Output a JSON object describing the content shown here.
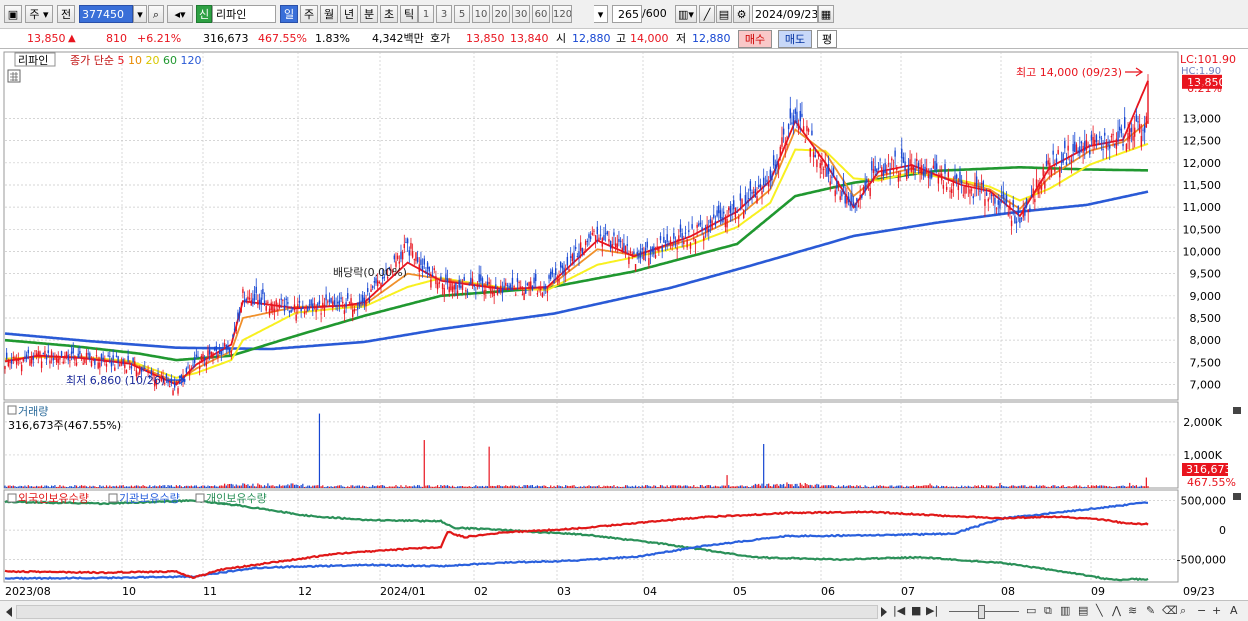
{
  "toolbar": {
    "type_label": "주",
    "prev_label": "전",
    "code": "377450",
    "credit_badge": "신",
    "stock_name": "리파인",
    "periods": [
      "일",
      "주",
      "월",
      "년",
      "분",
      "초",
      "틱"
    ],
    "active_period": "일",
    "intervals": [
      "1",
      "3",
      "5",
      "10",
      "20",
      "30",
      "60",
      "120"
    ],
    "count": "265",
    "count_total": "/600",
    "date": "2024/09/23"
  },
  "quote": {
    "price": "13,850",
    "change": "810",
    "rate": "+6.21%",
    "volume": "316,673",
    "volume_ratio": "467.55%",
    "turnover": "1.83%",
    "amount": "4,342백만",
    "ask_label": "호가",
    "ask": "13,850",
    "bid": "13,840",
    "open_label": "시",
    "open": "12,880",
    "high_label": "고",
    "high": "14,000",
    "low_label": "저",
    "low": "12,880",
    "buy_label": "매수",
    "sell_label": "매도",
    "eval_label": "평"
  },
  "price_panel": {
    "stock_label": "리파인",
    "ma_legend_title": "종가 단순",
    "ma_periods": [
      "5",
      "10",
      "20",
      "60",
      "120"
    ],
    "lc_label": "LC:101.90",
    "hc_label": "HC:1.90",
    "current_price_label": "13,850",
    "change_rate_label": "6.21%",
    "high_annotation": "최고 14,000 (09/23)",
    "low_annotation": "최저 6,860 (10/26)",
    "dividend_annotation": "배당락(0.00%)"
  },
  "volume_panel": {
    "title": "거래량",
    "subtitle": "316,673주(467.55%)",
    "current_label": "316,673",
    "ratio_label": "467.55%"
  },
  "holding_panel": {
    "series_labels": [
      "외국인보유수량",
      "기관보유수량",
      "개인보유수량"
    ]
  },
  "colors": {
    "up": "#e8141e",
    "down": "#1646d2",
    "ma5": "#e8141e",
    "ma10": "#f0902a",
    "ma20": "#f8f020",
    "ma60": "#209830",
    "ma120": "#2a5ad6",
    "foreign": "#e01818",
    "institution": "#2a60dd",
    "individual": "#2a9058"
  },
  "chart_data": [
    {
      "type": "candlestick",
      "title": "리파인",
      "x_labels": [
        "2023/08",
        "10",
        "11",
        "12",
        "2024/01",
        "02",
        "03",
        "04",
        "05",
        "06",
        "07",
        "08",
        "09",
        "09/23"
      ],
      "y_ticks": [
        7000,
        7500,
        8000,
        8500,
        9000,
        9500,
        10000,
        10500,
        11000,
        11500,
        12000,
        12500,
        13000
      ],
      "y_range": [
        6650,
        14500
      ],
      "series": [
        {
          "name": "5",
          "anchors": [
            [
              0,
              7520
            ],
            [
              20,
              7650
            ],
            [
              45,
              7600
            ],
            [
              75,
              7470
            ],
            [
              103,
              7000
            ],
            [
              115,
              7450
            ],
            [
              136,
              7900
            ],
            [
              143,
              8880
            ],
            [
              175,
              8720
            ],
            [
              204,
              8780
            ],
            [
              216,
              8850
            ],
            [
              242,
              9750
            ],
            [
              262,
              9340
            ],
            [
              300,
              9150
            ],
            [
              326,
              9200
            ],
            [
              356,
              10250
            ],
            [
              378,
              9890
            ],
            [
              412,
              10340
            ],
            [
              440,
              10900
            ],
            [
              460,
              11600
            ],
            [
              475,
              12940
            ],
            [
              493,
              12000
            ],
            [
              510,
              11000
            ],
            [
              525,
              11800
            ],
            [
              545,
              11950
            ],
            [
              575,
              11500
            ],
            [
              592,
              11360
            ],
            [
              610,
              10800
            ],
            [
              628,
              11900
            ],
            [
              652,
              12380
            ],
            [
              672,
              12520
            ],
            [
              687,
              13850
            ]
          ]
        },
        {
          "name": "10",
          "anchors": [
            [
              0,
              7540
            ],
            [
              20,
              7640
            ],
            [
              45,
              7610
            ],
            [
              75,
              7500
            ],
            [
              103,
              7050
            ],
            [
              115,
              7360
            ],
            [
              136,
              7750
            ],
            [
              143,
              8500
            ],
            [
              175,
              8750
            ],
            [
              204,
              8780
            ],
            [
              216,
              8800
            ],
            [
              242,
              9500
            ],
            [
              262,
              9380
            ],
            [
              300,
              9160
            ],
            [
              326,
              9170
            ],
            [
              356,
              10050
            ],
            [
              378,
              9920
            ],
            [
              412,
              10270
            ],
            [
              440,
              10760
            ],
            [
              460,
              11400
            ],
            [
              475,
              12750
            ],
            [
              493,
              12230
            ],
            [
              510,
              11250
            ],
            [
              525,
              11700
            ],
            [
              545,
              11870
            ],
            [
              575,
              11560
            ],
            [
              592,
              11400
            ],
            [
              610,
              10960
            ],
            [
              628,
              11690
            ],
            [
              652,
              12270
            ],
            [
              672,
              12470
            ],
            [
              687,
              12930
            ]
          ]
        },
        {
          "name": "20",
          "anchors": [
            [
              0,
              7580
            ],
            [
              20,
              7620
            ],
            [
              45,
              7620
            ],
            [
              75,
              7530
            ],
            [
              103,
              7150
            ],
            [
              115,
              7260
            ],
            [
              136,
              7550
            ],
            [
              143,
              8000
            ],
            [
              175,
              8620
            ],
            [
              204,
              8730
            ],
            [
              216,
              8760
            ],
            [
              242,
              9200
            ],
            [
              262,
              9400
            ],
            [
              300,
              9180
            ],
            [
              326,
              9130
            ],
            [
              356,
              9700
            ],
            [
              378,
              9870
            ],
            [
              412,
              10150
            ],
            [
              440,
              10550
            ],
            [
              460,
              11100
            ],
            [
              475,
              12300
            ],
            [
              493,
              12270
            ],
            [
              510,
              11650
            ],
            [
              525,
              11600
            ],
            [
              545,
              11780
            ],
            [
              575,
              11600
            ],
            [
              592,
              11460
            ],
            [
              610,
              11150
            ],
            [
              628,
              11420
            ],
            [
              652,
              11960
            ],
            [
              672,
              12230
            ],
            [
              687,
              12430
            ]
          ]
        },
        {
          "name": "60",
          "anchors": [
            [
              0,
              8000
            ],
            [
              40,
              7870
            ],
            [
              80,
              7700
            ],
            [
              103,
              7550
            ],
            [
              136,
              7650
            ],
            [
              175,
              8100
            ],
            [
              216,
              8550
            ],
            [
              262,
              9000
            ],
            [
              326,
              9180
            ],
            [
              378,
              9550
            ],
            [
              440,
              10170
            ],
            [
              475,
              11250
            ],
            [
              510,
              11550
            ],
            [
              560,
              11820
            ],
            [
              610,
              11900
            ],
            [
              650,
              11850
            ],
            [
              687,
              11830
            ]
          ]
        },
        {
          "name": "120",
          "anchors": [
            [
              0,
              8150
            ],
            [
              50,
              7980
            ],
            [
              103,
              7830
            ],
            [
              160,
              7800
            ],
            [
              216,
              7960
            ],
            [
              262,
              8250
            ],
            [
              330,
              8600
            ],
            [
              400,
              9180
            ],
            [
              450,
              9700
            ],
            [
              510,
              10350
            ],
            [
              560,
              10650
            ],
            [
              610,
              10900
            ],
            [
              650,
              11050
            ],
            [
              687,
              11350
            ]
          ]
        }
      ],
      "candle_anchors": [
        [
          0,
          7500
        ],
        [
          20,
          7650
        ],
        [
          45,
          7600
        ],
        [
          75,
          7450
        ],
        [
          103,
          6950
        ],
        [
          115,
          7500
        ],
        [
          136,
          7900
        ],
        [
          143,
          9000
        ],
        [
          175,
          8700
        ],
        [
          204,
          8800
        ],
        [
          216,
          8850
        ],
        [
          242,
          10100
        ],
        [
          262,
          9300
        ],
        [
          300,
          9150
        ],
        [
          326,
          9200
        ],
        [
          356,
          10450
        ],
        [
          378,
          9850
        ],
        [
          412,
          10350
        ],
        [
          440,
          10900
        ],
        [
          460,
          11700
        ],
        [
          475,
          13100
        ],
        [
          493,
          11900
        ],
        [
          510,
          10900
        ],
        [
          525,
          11900
        ],
        [
          545,
          11950
        ],
        [
          575,
          11450
        ],
        [
          592,
          11300
        ],
        [
          610,
          10700
        ],
        [
          628,
          12000
        ],
        [
          652,
          12400
        ],
        [
          672,
          12550
        ],
        [
          686,
          12900
        ],
        [
          687,
          13850
        ]
      ],
      "last_candle": {
        "open": 12880,
        "high": 14000,
        "low": 12880,
        "close": 13850
      }
    },
    {
      "type": "bar",
      "title": "거래량",
      "y_ticks": [
        1000,
        2000
      ],
      "y_tick_labels": [
        "1,000K",
        "2,000K"
      ],
      "y_range": [
        0,
        2600
      ],
      "baseline": 55,
      "spikes": [
        [
          189,
          2250
        ],
        [
          252,
          1450
        ],
        [
          291,
          1250
        ],
        [
          434,
          390
        ],
        [
          456,
          1330
        ],
        [
          470,
          170
        ],
        [
          478,
          155
        ],
        [
          481,
          150
        ],
        [
          556,
          135
        ],
        [
          598,
          150
        ],
        [
          676,
          155
        ],
        [
          686,
          316.673
        ]
      ]
    },
    {
      "type": "line",
      "title": "보유수량",
      "y_ticks": [
        500000,
        0,
        -500000
      ],
      "y_tick_labels": [
        "500,000",
        "0",
        "-500,000"
      ],
      "y_range": [
        -880000,
        680000
      ],
      "series": [
        {
          "name": "외국인보유수량",
          "anchors": [
            [
              0,
              -700000
            ],
            [
              60,
              -720000
            ],
            [
              103,
              -700000
            ],
            [
              113,
              -810000
            ],
            [
              130,
              -670000
            ],
            [
              160,
              -550000
            ],
            [
              200,
              -400000
            ],
            [
              240,
              -320000
            ],
            [
              262,
              -290000
            ],
            [
              266,
              -30000
            ],
            [
              276,
              -120000
            ],
            [
              300,
              -40000
            ],
            [
              340,
              20000
            ],
            [
              380,
              120000
            ],
            [
              420,
              220000
            ],
            [
              470,
              290000
            ],
            [
              520,
              310000
            ],
            [
              560,
              250000
            ],
            [
              600,
              200000
            ],
            [
              630,
              230000
            ],
            [
              660,
              180000
            ],
            [
              672,
              120000
            ],
            [
              687,
              100000
            ]
          ]
        },
        {
          "name": "기관보유수량",
          "anchors": [
            [
              0,
              -820000
            ],
            [
              60,
              -810000
            ],
            [
              113,
              -790000
            ],
            [
              150,
              -640000
            ],
            [
              216,
              -590000
            ],
            [
              262,
              -610000
            ],
            [
              300,
              -550000
            ],
            [
              340,
              -520000
            ],
            [
              380,
              -450000
            ],
            [
              420,
              -270000
            ],
            [
              470,
              -100000
            ],
            [
              520,
              -90000
            ],
            [
              570,
              -60000
            ],
            [
              600,
              200000
            ],
            [
              640,
              320000
            ],
            [
              687,
              470000
            ]
          ]
        },
        {
          "name": "개인보유수량",
          "anchors": [
            [
              0,
              480000
            ],
            [
              60,
              450000
            ],
            [
              113,
              500000
            ],
            [
              140,
              420000
            ],
            [
              180,
              250000
            ],
            [
              216,
              170000
            ],
            [
              262,
              150000
            ],
            [
              270,
              40000
            ],
            [
              300,
              0
            ],
            [
              350,
              -80000
            ],
            [
              400,
              -250000
            ],
            [
              450,
              -460000
            ],
            [
              500,
              -500000
            ],
            [
              550,
              -460000
            ],
            [
              600,
              -560000
            ],
            [
              640,
              -720000
            ],
            [
              665,
              -840000
            ],
            [
              687,
              -830000
            ]
          ]
        }
      ]
    }
  ]
}
